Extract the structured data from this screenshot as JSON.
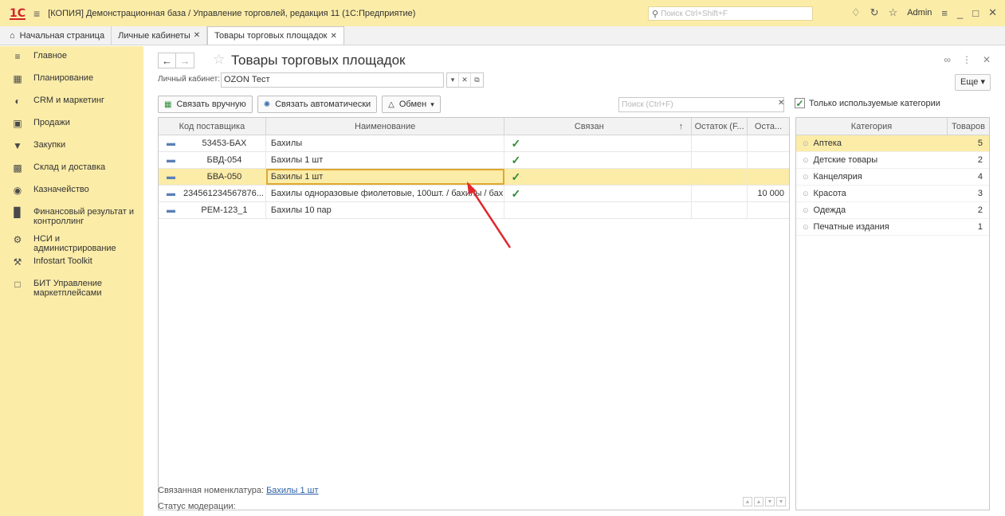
{
  "titlebar": {
    "logo": "1С",
    "title": "[КОПИЯ] Демонстрационная база / Управление торговлей, редакция 11  (1С:Предприятие)",
    "search_placeholder": "Поиск Ctrl+Shift+F",
    "user": "Admin"
  },
  "tabs": {
    "home": "Начальная страница",
    "items": [
      {
        "label": "Личные кабинеты"
      },
      {
        "label": "Товары торговых площадок"
      }
    ]
  },
  "sidebar": {
    "items": [
      {
        "label": "Главное"
      },
      {
        "label": "Планирование"
      },
      {
        "label": "CRM и маркетинг"
      },
      {
        "label": "Продажи"
      },
      {
        "label": "Закупки"
      },
      {
        "label": "Склад и доставка"
      },
      {
        "label": "Казначейство"
      },
      {
        "label": "Финансовый результат и контроллинг"
      },
      {
        "label": "НСИ и администрирование"
      },
      {
        "label": "Infostart Toolkit"
      },
      {
        "label": "БИТ Управление маркетплейсами"
      }
    ]
  },
  "page": {
    "title": "Товары торговых площадок",
    "cabinet_label": "Личный кабинет:",
    "cabinet_value": "OZON Тест",
    "more": "Еще",
    "buttons": {
      "link_manual": "Связать вручную",
      "link_auto": "Связать автоматически",
      "exchange": "Обмен"
    },
    "search_placeholder": "Поиск (Ctrl+F)",
    "only_used": "Только используемые категории"
  },
  "grid": {
    "columns": {
      "code": "Код поставщика",
      "name": "Наименование",
      "linked": "Связан",
      "rest1": "Остаток (F...",
      "rest2": "Оста..."
    },
    "rows": [
      {
        "code": "53453-БАХ",
        "name": "Бахилы",
        "linked": "✓",
        "rest": ""
      },
      {
        "code": "БВД-054",
        "name": "Бахилы 1 шт",
        "linked": "✓",
        "rest": ""
      },
      {
        "code": "БВА-050",
        "name": "Бахилы 1 шт",
        "linked": "✓",
        "rest": ""
      },
      {
        "code": "234561234567876...",
        "name": "Бахилы одноразовые фиолетовые, 100шт. / бахилы / бахи...",
        "linked": "✓",
        "rest": "10 000"
      },
      {
        "code": "РЕМ-123_1",
        "name": "Бахилы 10 пар",
        "linked": "",
        "rest": ""
      }
    ]
  },
  "footer": {
    "linked_label": "Связанная номенклатура:",
    "linked_value": "Бахилы 1 шт",
    "status_label": "Статус модерации:"
  },
  "categories": {
    "col_name": "Категория",
    "col_count": "Товаров",
    "rows": [
      {
        "name": "Аптека",
        "count": "5"
      },
      {
        "name": "Детские товары",
        "count": "2"
      },
      {
        "name": "Канцелярия",
        "count": "4"
      },
      {
        "name": "Красота",
        "count": "3"
      },
      {
        "name": "Одежда",
        "count": "2"
      },
      {
        "name": "Печатные издания",
        "count": "1"
      }
    ]
  },
  "colors": {
    "accent": "#fbeca8",
    "selection_border": "#e0a82e",
    "check": "#2f8a36",
    "annotation_arrow": "#e0282e"
  }
}
